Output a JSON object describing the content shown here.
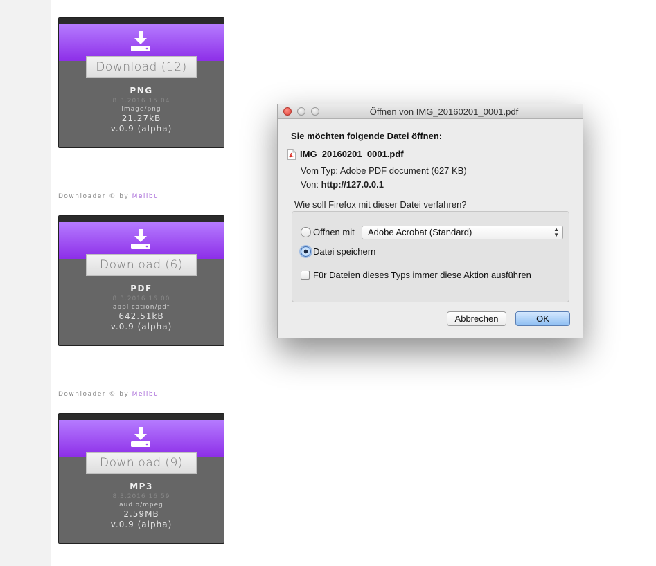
{
  "cards": [
    {
      "button": "Download (12)",
      "type": "PNG",
      "date": "8.3.2016 15:04",
      "mime": "image/png",
      "size": "21.27kB",
      "version": "v.0.9 (alpha)"
    },
    {
      "button": "Download (6)",
      "type": "PDF",
      "date": "8.3.2016 16:00",
      "mime": "application/pdf",
      "size": "642.51kB",
      "version": "v.0.9 (alpha)"
    },
    {
      "button": "Download (9)",
      "type": "MP3",
      "date": "8.3.2016 16:59",
      "mime": "audio/mpeg",
      "size": "2.59MB",
      "version": "v.0.9 (alpha)"
    }
  ],
  "credit": {
    "prefix": "Downloader © by ",
    "link": "Melibu"
  },
  "icons": {
    "download": "download-tray-icon",
    "pdf": "pdf-file-icon"
  },
  "colors": {
    "card_accent": "#9b4cf0",
    "card_body": "#666666",
    "link": "#a86ad8"
  },
  "dialog": {
    "title": "Öffnen von IMG_20160201_0001.pdf",
    "heading": "Sie möchten folgende Datei öffnen:",
    "filename": "IMG_20160201_0001.pdf",
    "type_label": "Vom Typ:",
    "type_value": "Adobe PDF document (627 KB)",
    "from_label": "Von:",
    "from_value": "http://127.0.0.1",
    "question": "Wie soll Firefox mit dieser Datei verfahren?",
    "open_with_label": "Öffnen mit",
    "open_with_app": "Adobe Acrobat (Standard)",
    "save_label": "Datei speichern",
    "selected_option": "save",
    "always_label": "Für Dateien dieses Typs immer diese Aktion ausführen",
    "always_checked": false,
    "cancel": "Abbrechen",
    "ok": "OK"
  }
}
